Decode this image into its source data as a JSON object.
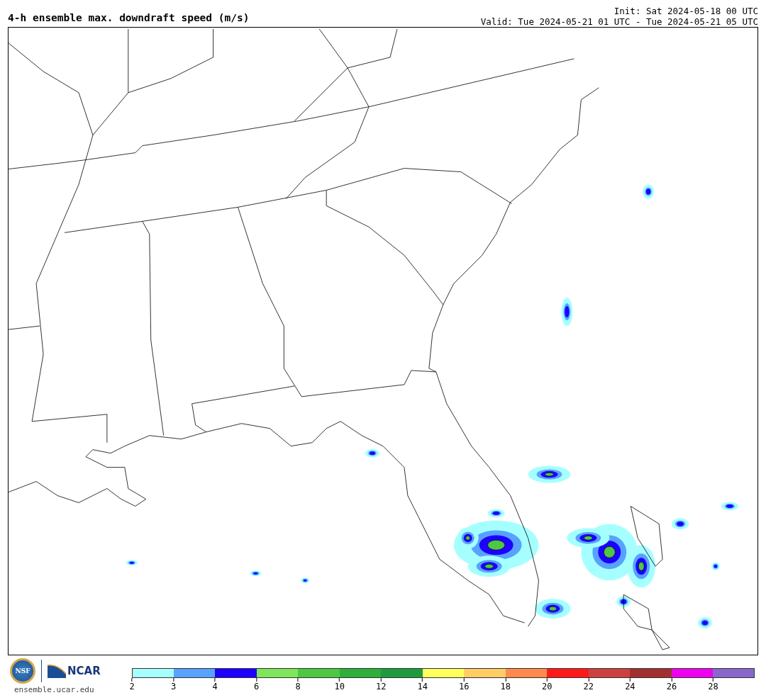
{
  "header": {
    "title": "4-h ensemble max. downdraft speed (m/s)",
    "init": "Init: Sat 2024-05-18 00 UTC",
    "valid": "Valid: Tue 2024-05-21 01 UTC - Tue 2024-05-21 05 UTC"
  },
  "logos": {
    "seal_text": "NSF",
    "ncar_text": "NCAR",
    "url": "ensemble.ucar.edu"
  },
  "colorbar": {
    "segments": [
      {
        "color": "#a6ffff",
        "label": "2"
      },
      {
        "color": "#58a2ff",
        "label": "3"
      },
      {
        "color": "#1e00ff",
        "label": "4"
      },
      {
        "color": "#7fe55a",
        "label": "6"
      },
      {
        "color": "#4ec843",
        "label": "8"
      },
      {
        "color": "#2eae3a",
        "label": "10"
      },
      {
        "color": "#1f9a3f",
        "label": "12"
      },
      {
        "color": "#ffff5e",
        "label": "14"
      },
      {
        "color": "#ffcc66",
        "label": "16"
      },
      {
        "color": "#ff8a4d",
        "label": "18"
      },
      {
        "color": "#ff1a1a",
        "label": "20"
      },
      {
        "color": "#cc4040",
        "label": "22"
      },
      {
        "color": "#a33030",
        "label": "24"
      },
      {
        "color": "#ee00ee",
        "label": "26"
      },
      {
        "color": "#8866cc",
        "label": "28"
      }
    ]
  }
}
